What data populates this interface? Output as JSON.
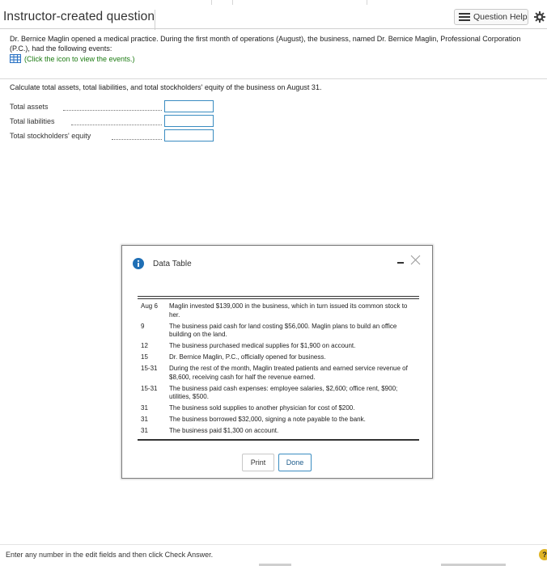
{
  "header": {
    "title": "Instructor-created question",
    "help_label": "Question Help"
  },
  "problem": {
    "text": "Dr. Bernice Maglin opened a medical practice. During the first month of operations (August), the business, named Dr. Bernice Maglin, Professional Corporation (P.C.), had the following events:",
    "link_text": "(Click the icon to view the events.)",
    "instruction": "Calculate total assets, total liabilities, and total stockholders' equity of the business on August 31."
  },
  "answers": [
    {
      "label": "Total assets",
      "value": ""
    },
    {
      "label": "Total liabilities",
      "value": ""
    },
    {
      "label": "Total stockholders' equity",
      "value": ""
    }
  ],
  "modal": {
    "title": "Data Table",
    "events": [
      {
        "date": "Aug 6",
        "text": "Maglin invested $139,000 in the business, which in turn issued its common stock to her."
      },
      {
        "date": "9",
        "text": "The business paid cash for land costing $56,000. Maglin plans to build an office building on the land."
      },
      {
        "date": "12",
        "text": "The business purchased medical supplies for $1,900 on account."
      },
      {
        "date": "15",
        "text": "Dr. Bernice Maglin, P.C., officially opened for business."
      },
      {
        "date": "15-31",
        "text": "During the rest of the month, Maglin treated patients and earned service revenue of $8,600, receiving cash for half the revenue earned."
      },
      {
        "date": "15-31",
        "text": "The business paid cash expenses: employee salaries, $2,600; office rent, $900; utilities, $500."
      },
      {
        "date": "31",
        "text": "The business sold supplies to another physician for cost of $200."
      },
      {
        "date": "31",
        "text": "The business borrowed $32,000, signing a note payable to the bank."
      },
      {
        "date": "31",
        "text": "The business paid $1,300 on account."
      }
    ],
    "print_label": "Print",
    "done_label": "Done"
  },
  "footer": {
    "text": "Enter any number in the edit fields and then click Check Answer.",
    "help_glyph": "?"
  },
  "colors": {
    "accent": "#3a8cc1",
    "link": "#1c7b12",
    "info": "#1f6fb5"
  }
}
